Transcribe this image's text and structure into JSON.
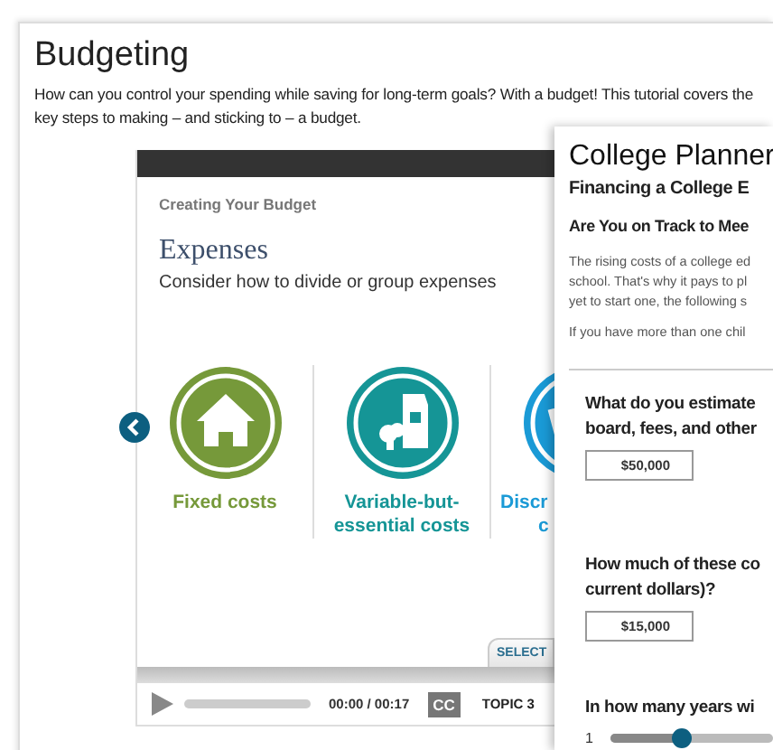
{
  "page": {
    "title": "Budgeting",
    "description": "How can you control your spending while saving for long-term goals? With a budget! This tutorial covers the key steps to making – and sticking to – a budget."
  },
  "player": {
    "section": "Creating Your Budget",
    "heading": "Expenses",
    "subheading": "Consider how to divide or group expenses",
    "cards": [
      {
        "kind": "house",
        "color": "#76993a",
        "lines": [
          "Fixed costs"
        ]
      },
      {
        "kind": "groceries",
        "color": "#159596",
        "lines": [
          "Variable-but-",
          "essential costs"
        ]
      },
      {
        "kind": "partial",
        "color": "#1a9ad6",
        "lines": [
          "Discr",
          "c"
        ]
      }
    ],
    "tab": "SELECT",
    "time": "00:00 / 00:17",
    "cc": "CC",
    "topic": "TOPIC 3"
  },
  "planner": {
    "title": "College Planner",
    "subtitle": "Financing a College E",
    "heading": "Are You on Track to Mee",
    "paragraph": [
      "The rising costs of a college ed",
      "school. That's why it pays to pl",
      "yet to start one, the following s"
    ],
    "note": "If you have more than one chil",
    "questions": [
      {
        "kind": "input",
        "lines": [
          "What do you estimate",
          "board, fees, and other"
        ],
        "value": "$50,000"
      },
      {
        "kind": "input",
        "lines": [
          "How much of these co",
          "current dollars)?"
        ],
        "value": "$15,000"
      },
      {
        "kind": "slider",
        "lines": [
          "In how many years wi"
        ],
        "min": "1",
        "level": 0.43
      }
    ]
  }
}
